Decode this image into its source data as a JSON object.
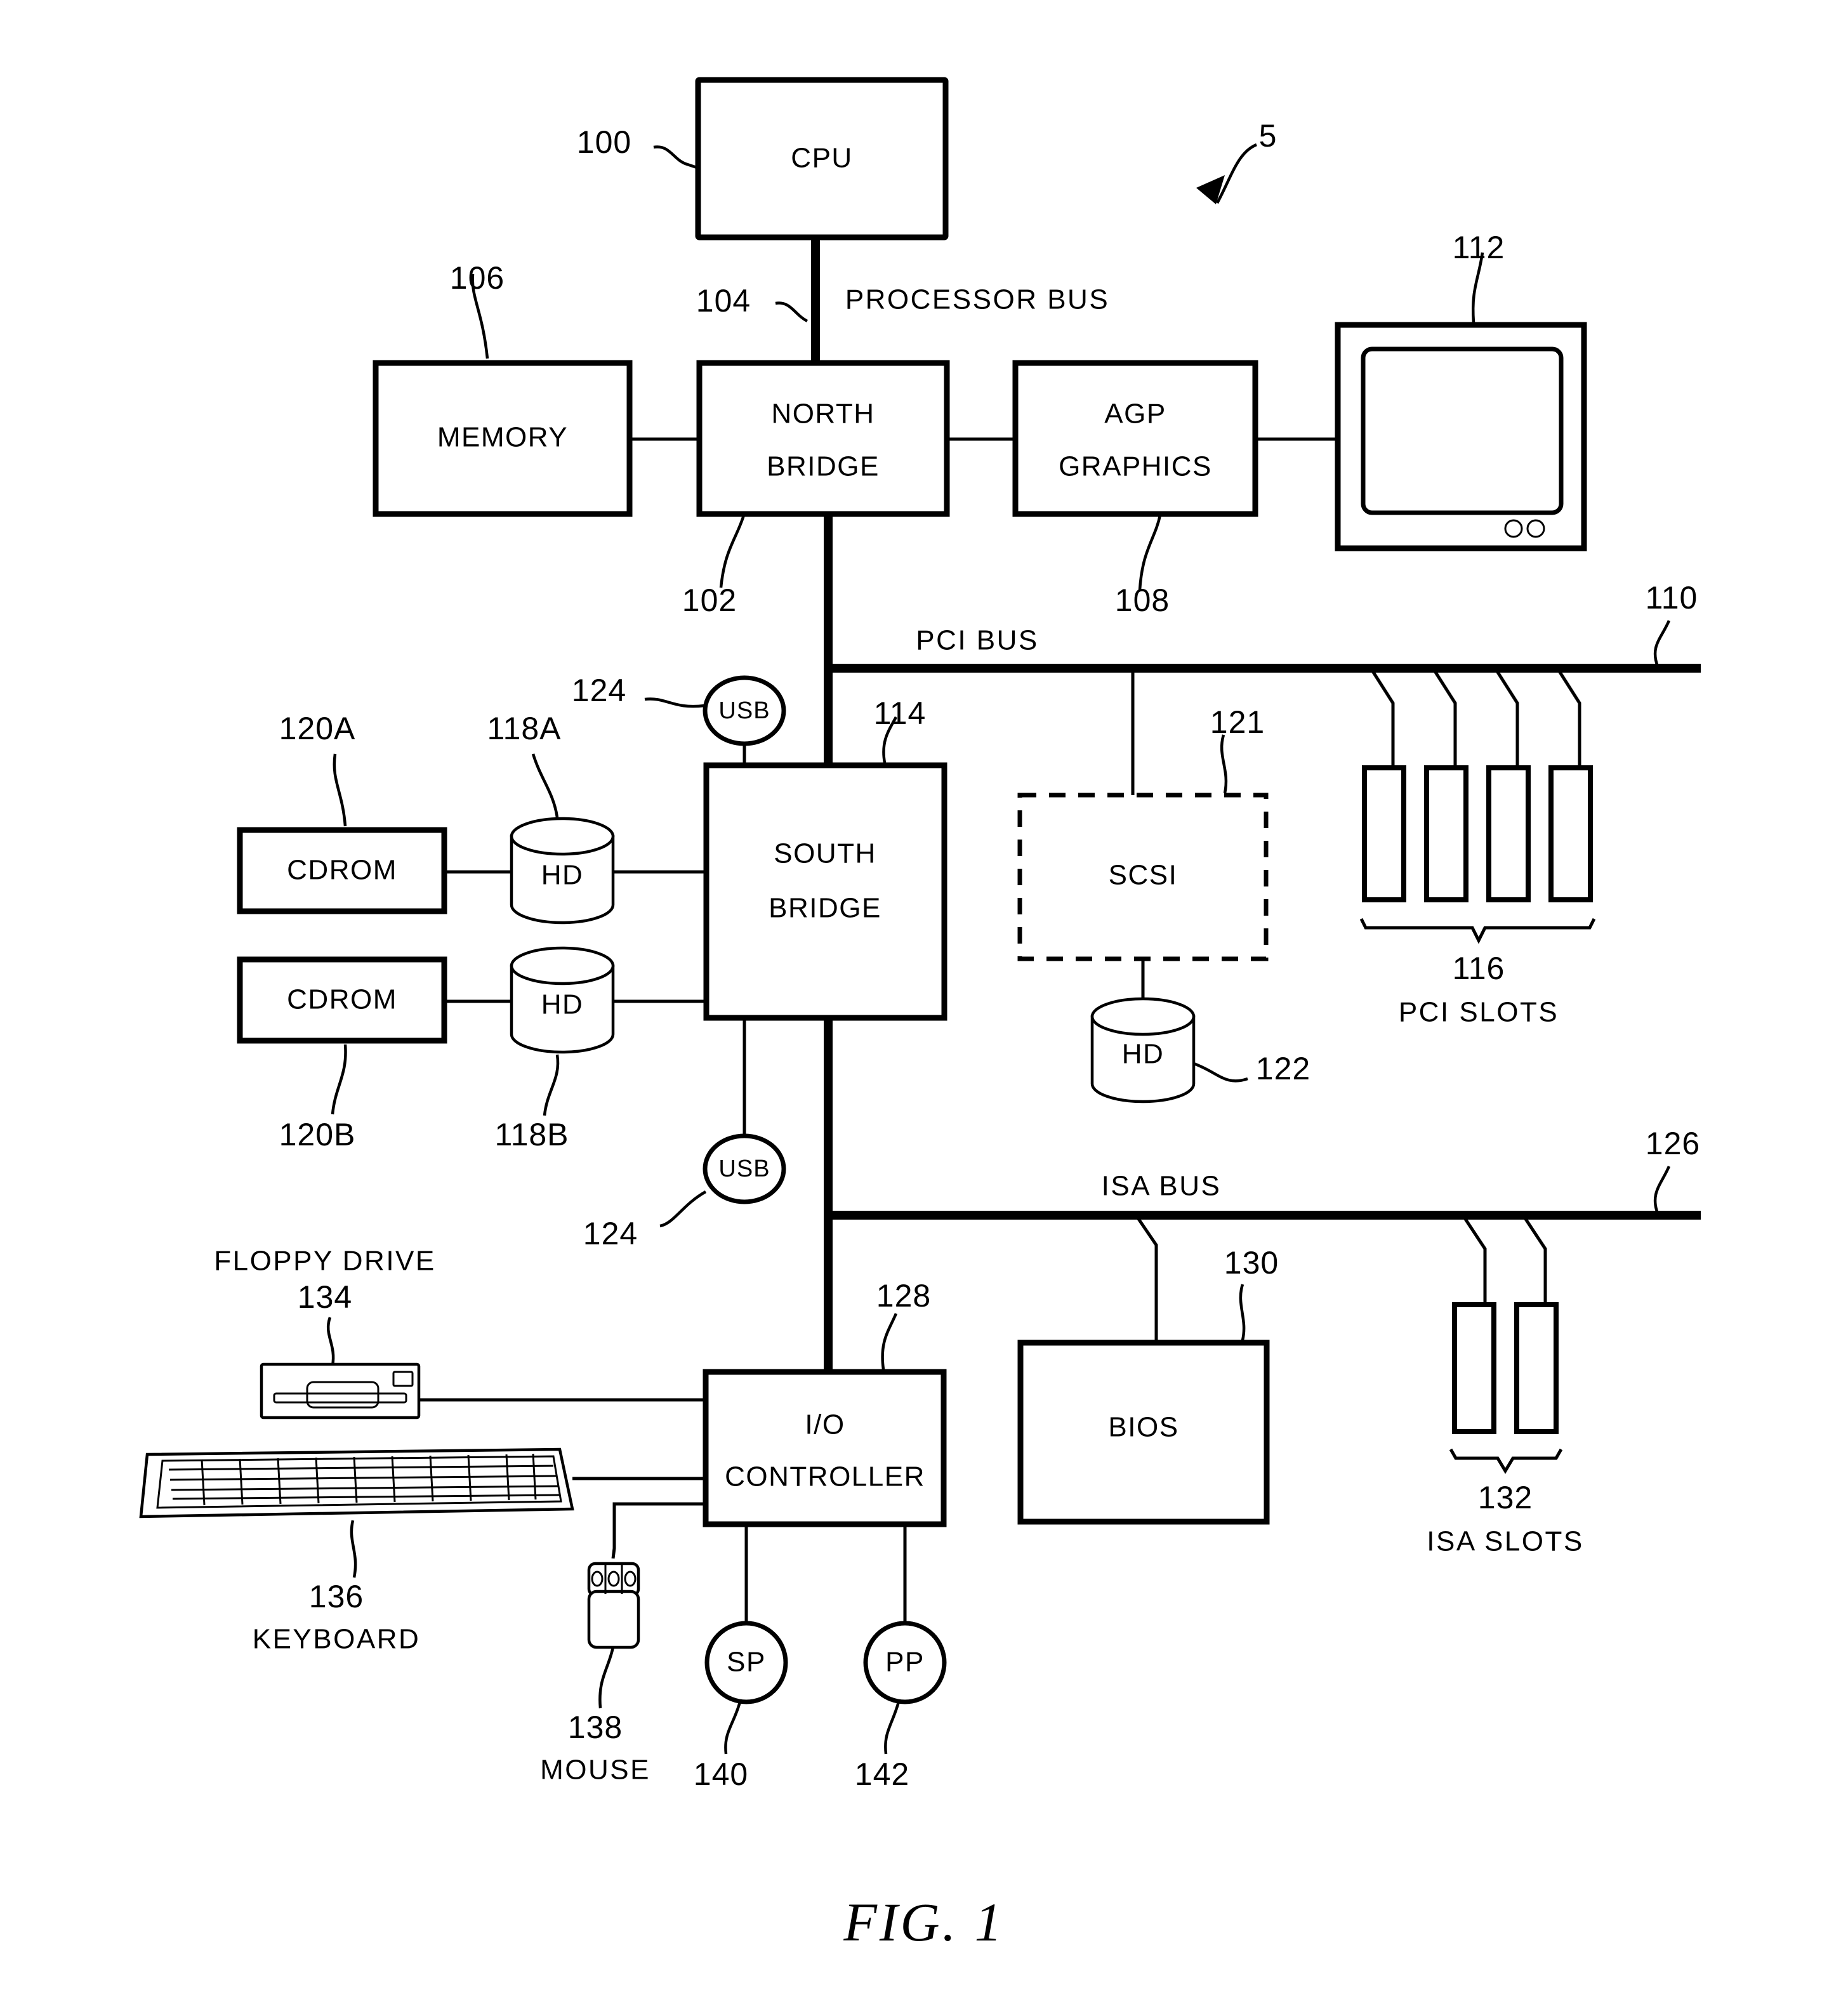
{
  "figure": {
    "caption": "FIG.  1",
    "system_ref": "5"
  },
  "blocks": {
    "cpu": {
      "label": "CPU",
      "ref": "100"
    },
    "memory": {
      "label": "MEMORY",
      "ref": "106"
    },
    "northbridge": {
      "label_line1": "NORTH",
      "label_line2": "BRIDGE",
      "ref": "102"
    },
    "agp": {
      "label_line1": "AGP",
      "label_line2": "GRAPHICS",
      "ref": "108"
    },
    "monitor": {
      "ref": "112"
    },
    "southbridge": {
      "label_line1": "SOUTH",
      "label_line2": "BRIDGE",
      "ref": "114"
    },
    "scsi": {
      "label": "SCSI",
      "ref": "121"
    },
    "scsi_hd": {
      "label": "HD",
      "ref": "122"
    },
    "bios": {
      "label": "BIOS",
      "ref": "130"
    },
    "iocontroller": {
      "label_line1": "I/O",
      "label_line2": "CONTROLLER",
      "ref": "128"
    },
    "cdrom_a": {
      "label": "CDROM",
      "ref": "120A"
    },
    "cdrom_b": {
      "label": "CDROM",
      "ref": "120B"
    },
    "hd_a": {
      "label": "HD",
      "ref": "118A"
    },
    "hd_b": {
      "label": "HD",
      "ref": "118B"
    },
    "usb_top": {
      "label": "USB",
      "ref": "124"
    },
    "usb_bottom": {
      "label": "USB",
      "ref": "124"
    },
    "serial_port": {
      "label": "SP",
      "ref": "140"
    },
    "parallel_port": {
      "label": "PP",
      "ref": "142"
    }
  },
  "buses": {
    "processor_bus": {
      "label": "PROCESSOR  BUS",
      "ref": "104"
    },
    "pci_bus": {
      "label": "PCI  BUS",
      "ref": "110"
    },
    "isa_bus": {
      "label": "ISA  BUS",
      "ref": "126"
    }
  },
  "slot_groups": {
    "pci_slots": {
      "ref": "116",
      "label": "PCI  SLOTS",
      "count": 4
    },
    "isa_slots": {
      "ref": "132",
      "label": "ISA  SLOTS",
      "count": 2
    }
  },
  "peripherals": {
    "floppy": {
      "label": "FLOPPY DRIVE",
      "ref": "134"
    },
    "keyboard": {
      "label": "KEYBOARD",
      "ref": "136"
    },
    "mouse": {
      "label": "MOUSE",
      "ref": "138"
    }
  },
  "colors": {
    "ink": "#000000",
    "paper": "#ffffff"
  }
}
